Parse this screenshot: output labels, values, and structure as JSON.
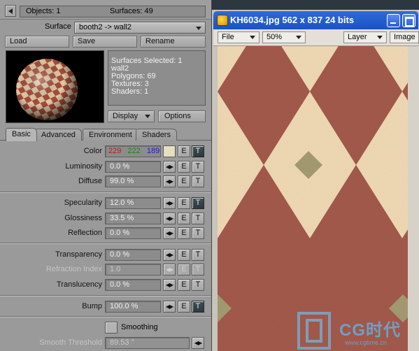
{
  "editor": {
    "objects_text": "Objects: 1",
    "surfaces_text": "Surfaces: 49",
    "surface_label": "Surface",
    "surface_value": "booth2 -> wall2",
    "buttons": {
      "load": "Load",
      "save": "Save",
      "rename": "Rename"
    },
    "stats": {
      "selected": "Surfaces Selected: 1",
      "name": "wall2",
      "polygons": "Polygons: 69",
      "textures": "Textures: 3",
      "shaders": "Shaders: 1"
    },
    "display_label": "Display",
    "options_label": "Options",
    "tabs": [
      "Basic",
      "Advanced",
      "Environment",
      "Shaders"
    ],
    "active_tab": "Basic",
    "color": {
      "label": "Color",
      "r": "229",
      "g": "222",
      "b": "189",
      "swatch": "#e5dec0",
      "r_color": "#c01818",
      "g_color": "#128a12",
      "b_color": "#1a1ad0"
    },
    "params": {
      "luminosity": {
        "label": "Luminosity",
        "value": "0.0 %"
      },
      "diffuse": {
        "label": "Diffuse",
        "value": "99.0 %"
      },
      "specularity": {
        "label": "Specularity",
        "value": "12.0 %"
      },
      "glossiness": {
        "label": "Glossiness",
        "value": "33.5 %"
      },
      "reflection": {
        "label": "Reflection",
        "value": "0.0 %"
      },
      "transparency": {
        "label": "Transparency",
        "value": "0.0 %"
      },
      "refraction": {
        "label": "Refraction Index",
        "value": "1.0"
      },
      "translucency": {
        "label": "Translucency",
        "value": "0.0 %"
      },
      "bump": {
        "label": "Bump",
        "value": "100.0 %"
      }
    },
    "smoothing_label": "Smoothing",
    "smooth_threshold": {
      "label": "Smooth Threshold",
      "value": "89.53 °"
    },
    "env_btn": "E",
    "tex_btn": "T",
    "arrows_glyph": "◀▶"
  },
  "viewer": {
    "title": "KH6034.jpg  562 x 837 24 bits",
    "file_menu": "File",
    "zoom": "50%",
    "layer_menu": "Layer",
    "image_menu": "Image",
    "tile_colors": {
      "dark": "#a35a4c",
      "light": "#f0d9b4",
      "accent": "#a59b72"
    }
  },
  "watermark": {
    "brand": "CG时代",
    "url": "www.cgtime.cn"
  }
}
